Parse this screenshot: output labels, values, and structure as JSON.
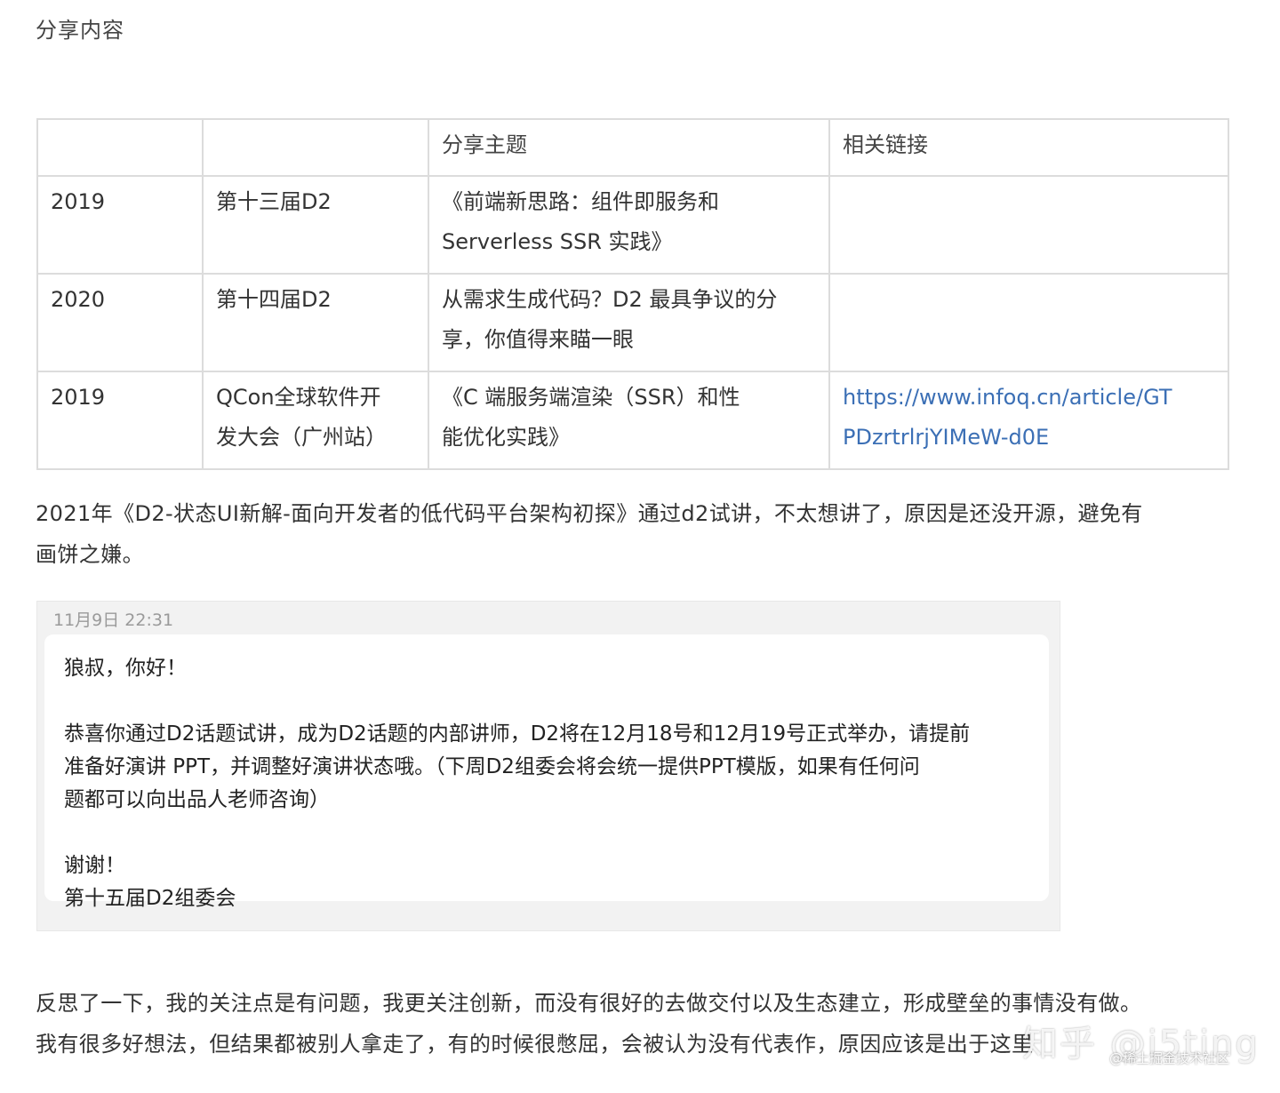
{
  "section_title": "分享内容",
  "table": {
    "headers": [
      "",
      "",
      "分享主题",
      "相关链接"
    ],
    "rows": [
      {
        "year": "2019",
        "event": "第十三届D2",
        "topic_line1": "《前端新思路：组件即服务和",
        "topic_line2": "Serverless SSR 实践》",
        "link_line1": "",
        "link_line2": ""
      },
      {
        "year": "2020",
        "event": "第十四届D2",
        "topic_line1": "从需求生成代码？D2 最具争议的分",
        "topic_line2": "享，你值得来瞄一眼",
        "link_line1": "",
        "link_line2": ""
      },
      {
        "year": "2019",
        "event_line1": "QCon全球软件开",
        "event_line2": "发大会（广州站）",
        "topic_line1": "《C 端服务端渲染（SSR）和性",
        "topic_line2": "能优化实践》",
        "link_line1": "https://www.infoq.cn/article/GT",
        "link_line2": "PDzrtrlrjYIMeW-d0E"
      }
    ]
  },
  "paragraph1_line1": "2021年《D2-状态UI新解-面向开发者的低代码平台架构初探》通过d2试讲，不太想讲了，原因是还没开源，避免有",
  "paragraph1_line2": "画饼之嫌。",
  "message": {
    "date": "11月9日 22:31",
    "greeting": "狼叔，你好！",
    "body_line1": "恭喜你通过D2话题试讲，成为D2话题的内部讲师，D2将在12月18号和12月19号正式举办，请提前",
    "body_line2": "准备好演讲 PPT，并调整好演讲状态哦。（下周D2组委会将会统一提供PPT模版，如果有任何问",
    "body_line3": "题都可以向出品人老师咨询）",
    "thanks": "谢谢！",
    "signature": "第十五届D2组委会"
  },
  "paragraph2_line1": "反思了一下，我的关注点是有问题，我更关注创新，而没有很好的去做交付以及生态建立，形成壁垒的事情没有做。",
  "paragraph2_line2": "我有很多好想法，但结果都被别人拿走了，有的时候很憋屈，会被认为没有代表作，原因应该是出于这里",
  "watermark": "知乎 @i5ting",
  "watermark_sub": "@稀土掘金技术社区",
  "colors": {
    "link": "#3b6fb5",
    "border": "#dcdcdc",
    "card_bg": "#f2f2f2"
  }
}
